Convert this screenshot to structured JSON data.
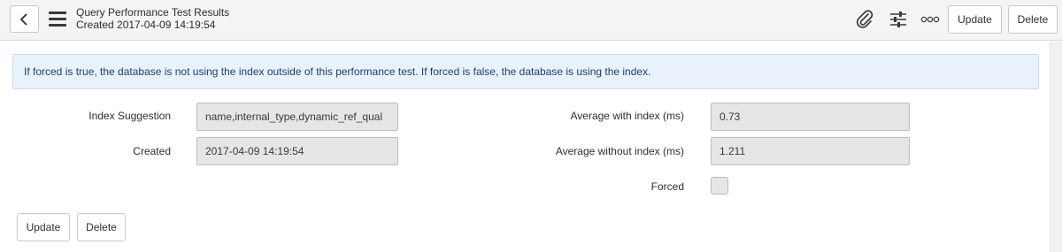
{
  "header": {
    "title": "Query Performance Test Results",
    "subtitle": "Created 2017-04-09 14:19:54",
    "update_label": "Update",
    "delete_label": "Delete"
  },
  "info": {
    "message": "If forced is true, the database is not using the index outside of this performance test. If forced is false, the database is using the index."
  },
  "form": {
    "index_suggestion_label": "Index Suggestion",
    "index_suggestion_value": "name,internal_type,dynamic_ref_qual",
    "created_label": "Created",
    "created_value": "2017-04-09 14:19:54",
    "avg_with_label": "Average with index (ms)",
    "avg_with_value": "0.73",
    "avg_without_label": "Average without index (ms)",
    "avg_without_value": "1.211",
    "forced_label": "Forced",
    "forced_checked": false
  },
  "footer": {
    "update_label": "Update",
    "delete_label": "Delete"
  },
  "icons": {
    "back": "chevron-left-icon",
    "menu": "hamburger-menu-icon",
    "attachment": "paperclip-icon",
    "personalize": "sliders-icon",
    "more": "more-options-icon"
  }
}
